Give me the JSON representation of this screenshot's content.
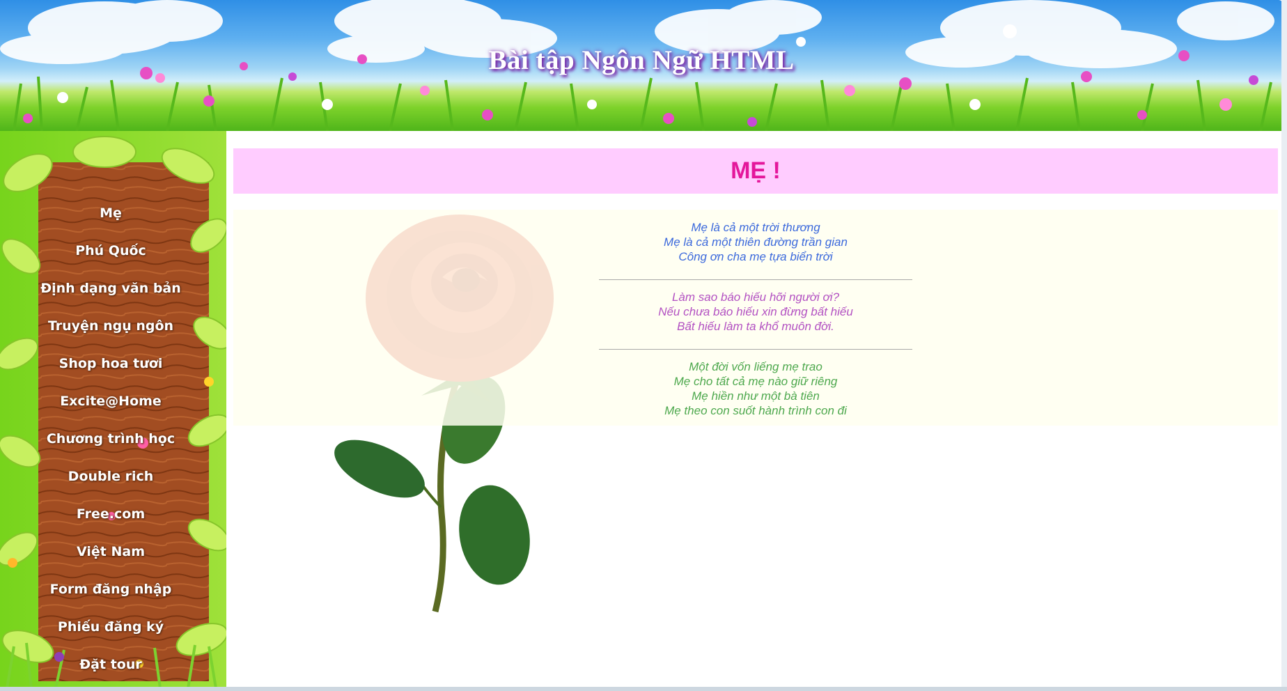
{
  "header": {
    "title": "Bài tập Ngôn Ngữ HTML"
  },
  "sidebar": {
    "items": [
      {
        "label": "Mẹ"
      },
      {
        "label": "Phú Quốc"
      },
      {
        "label": "Định dạng văn bản"
      },
      {
        "label": "Truyện ngụ ngôn"
      },
      {
        "label": "Shop hoa tươi"
      },
      {
        "label": "Excite@Home"
      },
      {
        "label": "Chương trình học"
      },
      {
        "label": "Double rich"
      },
      {
        "label": "Free.com"
      },
      {
        "label": "Việt Nam"
      },
      {
        "label": "Form đăng nhập"
      },
      {
        "label": "Phiếu đăng ký"
      },
      {
        "label": "Đặt tour"
      }
    ]
  },
  "main": {
    "title": "MẸ !",
    "stanzas": [
      {
        "color": "#1a4fd6",
        "lines": [
          "Mẹ là cả một trời thương",
          "Mẹ là cả một thiên đường trần gian",
          "Công ơn cha mẹ tựa biển trời"
        ]
      },
      {
        "color": "#a633b8",
        "lines": [
          "Làm sao báo hiếu hỡi người ơi?",
          "Nếu chưa báo hiếu xin đừng bất hiếu",
          "Bất hiếu làm ta khổ muôn đời."
        ]
      },
      {
        "color": "#2f9a2f",
        "lines": [
          "Một đời vốn liếng mẹ trao",
          "Mẹ cho tất cả mẹ nào giữ riêng",
          "Mẹ hiền như một bà tiên",
          "Mẹ theo con suốt hành trình con đi"
        ]
      }
    ]
  },
  "colors": {
    "title_bg": "#ffccff",
    "title_text": "#e4179b",
    "poem_bg": "#fffff0"
  }
}
